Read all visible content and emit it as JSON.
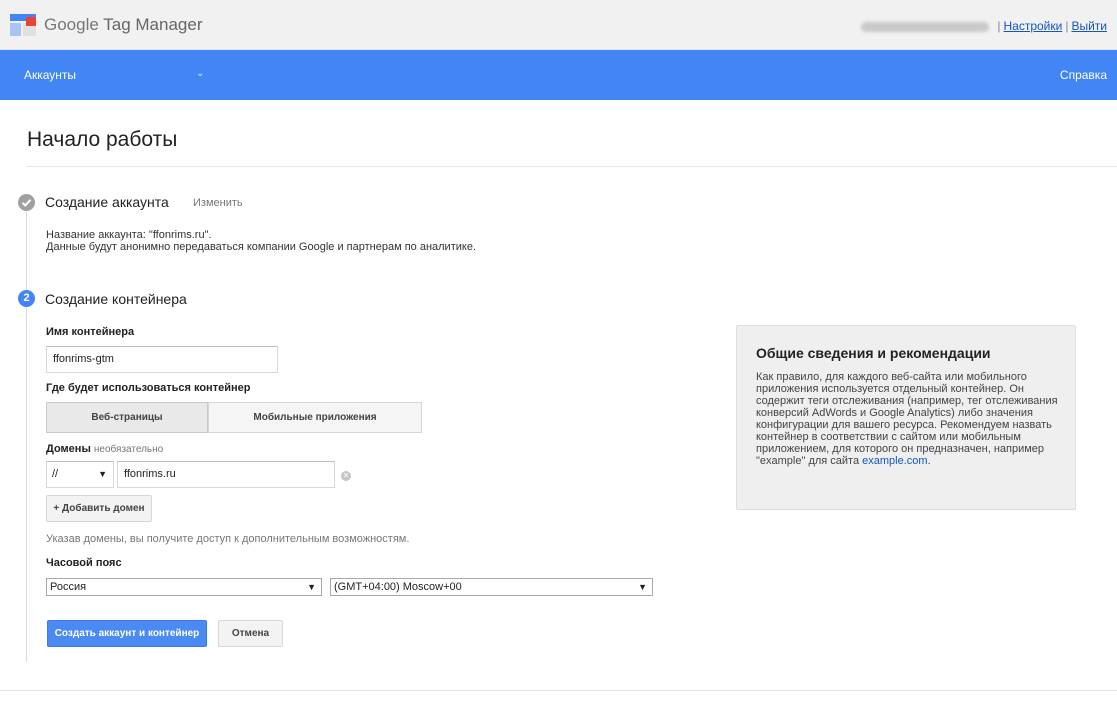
{
  "header": {
    "logo_google": "Google",
    "logo_product": "Tag Manager",
    "settings_link": "Настройки",
    "logout_link": "Выйти",
    "separator": "|"
  },
  "navbar": {
    "accounts_label": "Аккаунты",
    "chevron": "⌄",
    "help_label": "Справка"
  },
  "page": {
    "title": "Начало работы"
  },
  "step1": {
    "icon": "check-icon",
    "title": "Создание аккаунта",
    "edit_label": "Изменить",
    "info_line1": "Название аккаунта: \"ffonrims.ru\".",
    "info_line2": "Данные будут анонимно передаваться компании Google и партнерам по аналитике."
  },
  "step2": {
    "number": "2",
    "title": "Создание контейнера",
    "container_name_label": "Имя контейнера",
    "container_name_value": "ffonrims-gtm",
    "usage_label": "Где будет использоваться контейнер",
    "usage_options": [
      "Веб-страницы",
      "Мобильные приложения"
    ],
    "usage_selected": "Веб-страницы",
    "domains_label": "Домены",
    "domains_optional": "необязательно",
    "protocol_value": "//",
    "domain_value": "ffonrims.ru",
    "add_domain_label": "+ Добавить домен",
    "domains_hint": "Указав домены, вы получите доступ к дополнительным возможностям.",
    "timezone_label": "Часовой пояс",
    "country_value": "Россия",
    "timezone_value": "(GMT+04:00) Moscow+00",
    "create_button": "Создать аккаунт и контейнер",
    "cancel_button": "Отмена"
  },
  "info_card": {
    "title": "Общие сведения и рекомендации",
    "text": "Как правило, для каждого веб-сайта или мобильного приложения используется отдельный контейнер. Он содержит теги отслеживания (например, тег отслеживания конверсий AdWords и Google Analytics) либо значения конфигурации для вашего ресурса. Рекомендуем назвать контейнер в соответствии с сайтом или мобильным приложением, для которого он предназначен, например \"example\" для сайта",
    "link": "example.com",
    "after_link": "."
  },
  "colors": {
    "nav_blue": "#4285f4",
    "primary_button": "#4a8af4",
    "link": "#1155cc",
    "completed_step": "#a0a0a0"
  }
}
